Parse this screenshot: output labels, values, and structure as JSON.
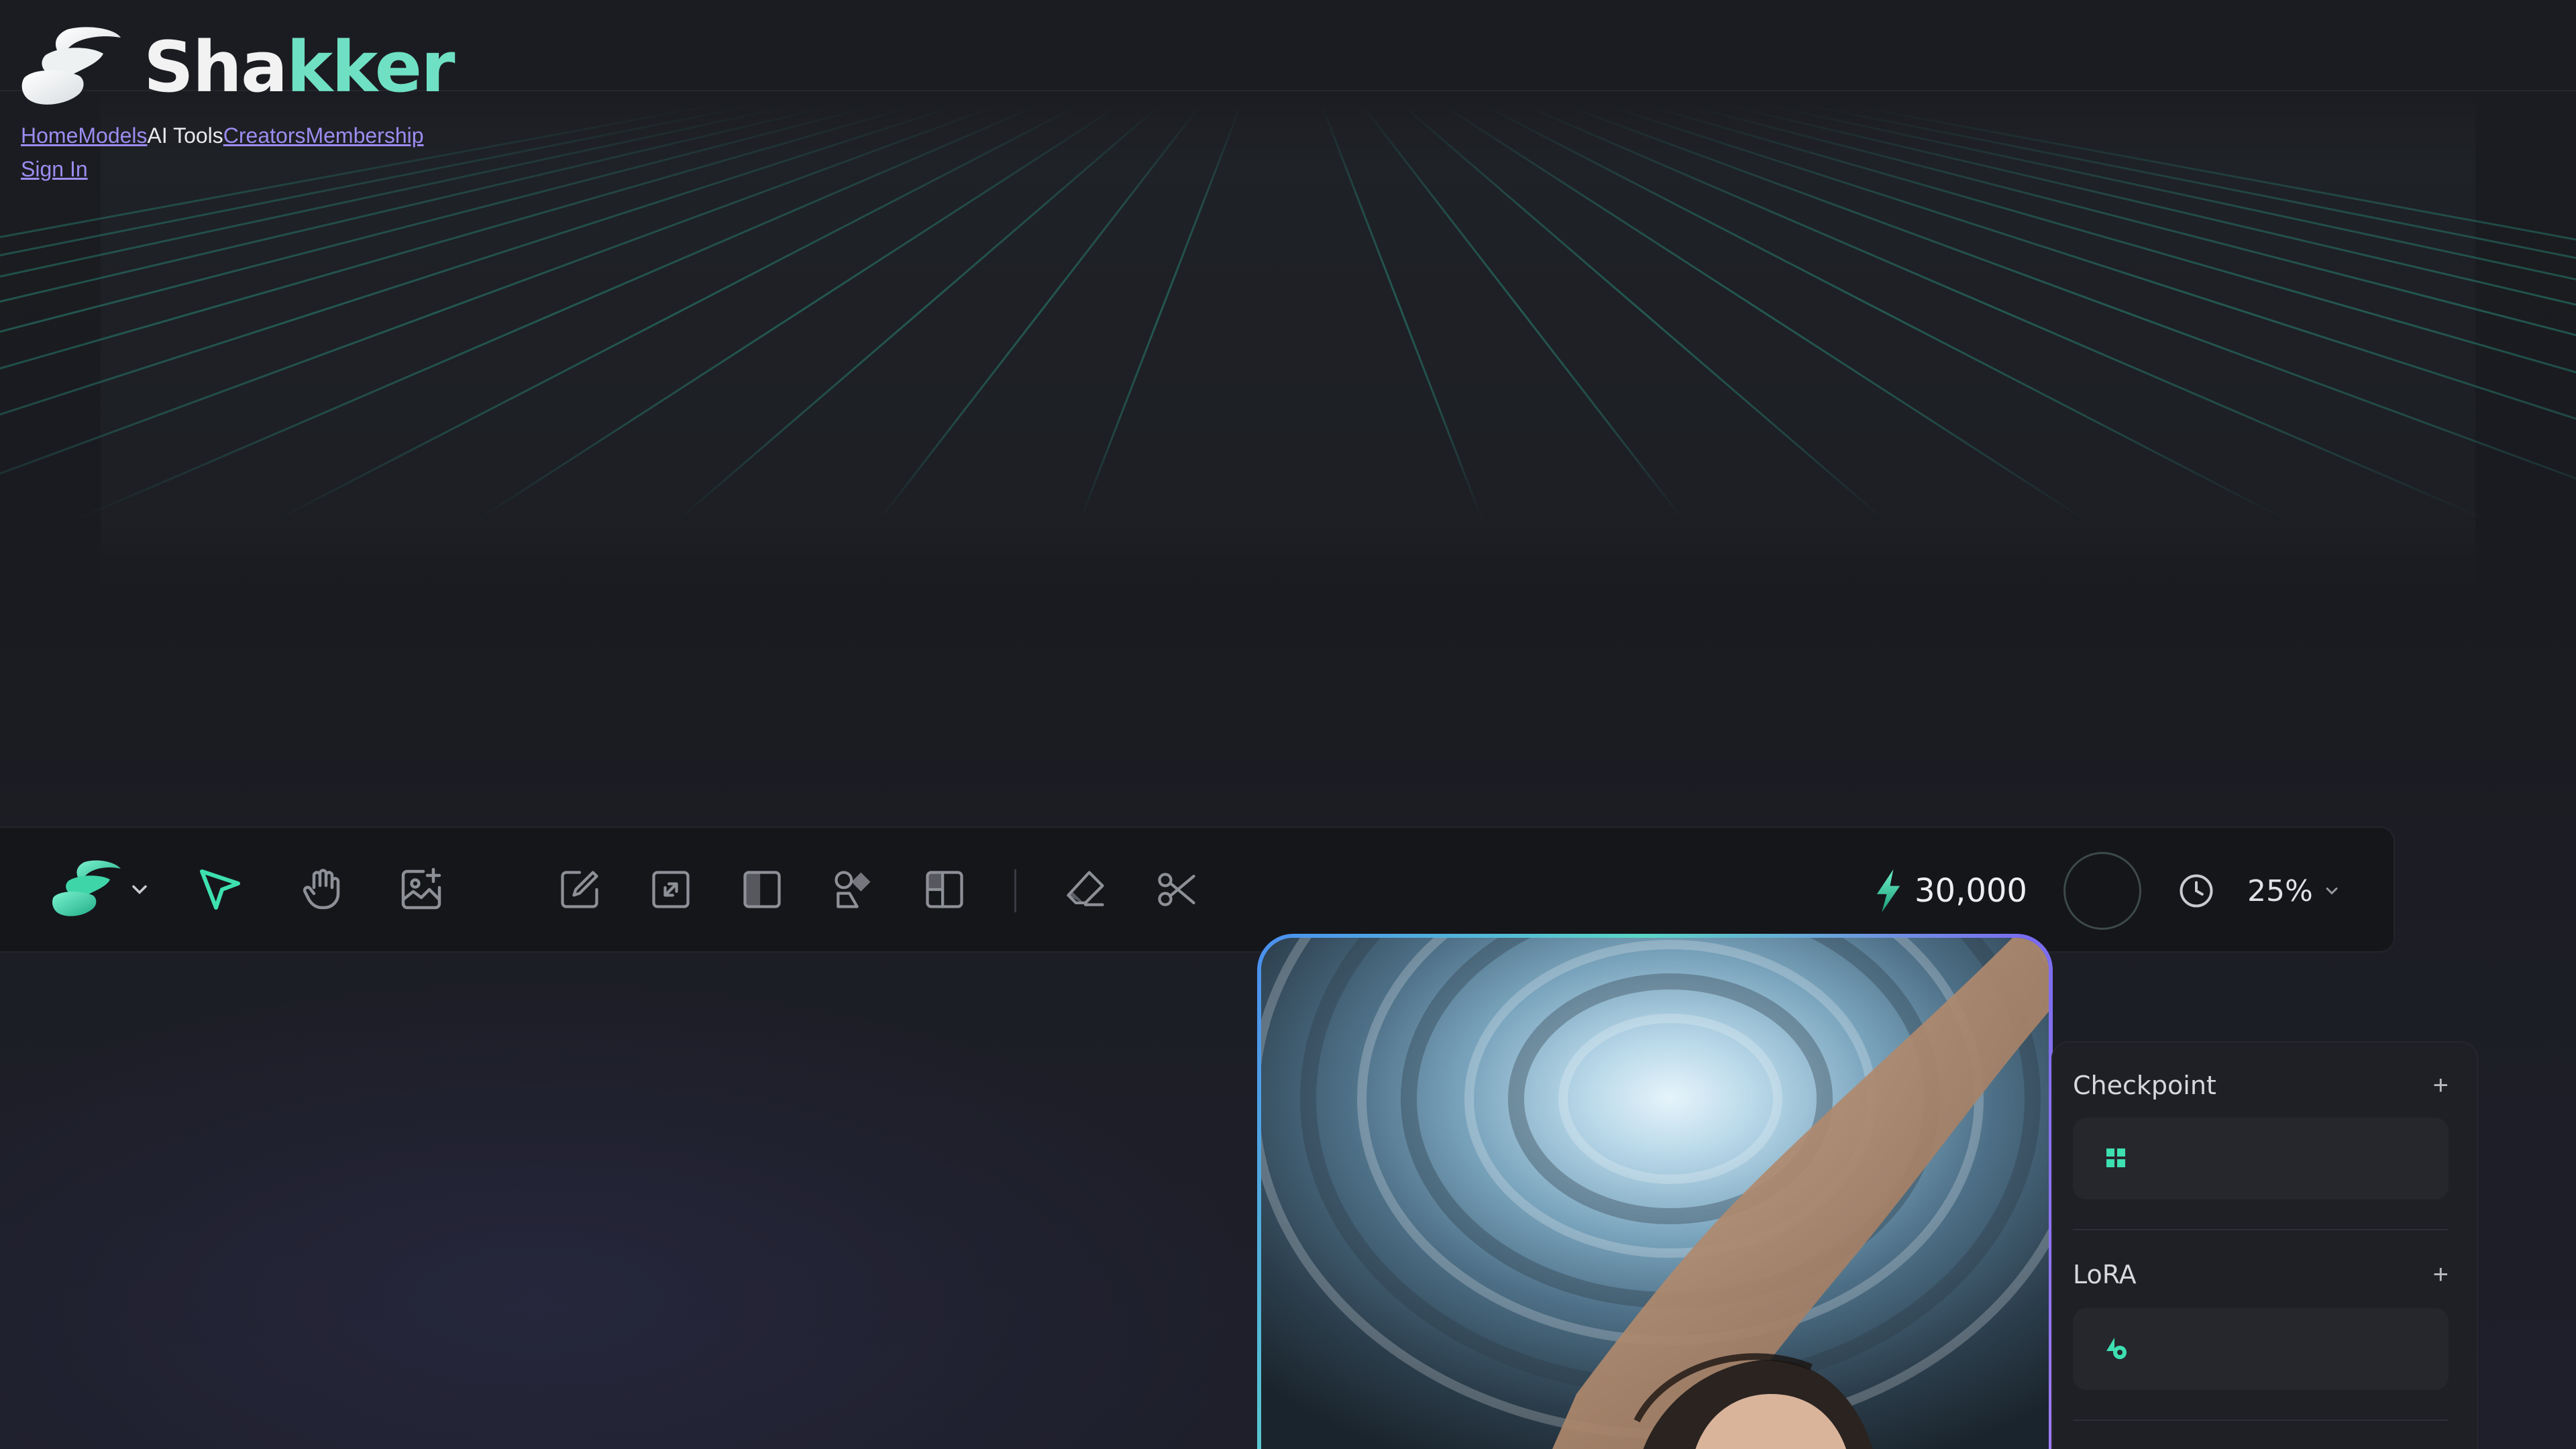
{
  "brand": {
    "name_main": "Sha",
    "name_accent": "kker"
  },
  "nav": {
    "items": [
      {
        "label": "Home",
        "link": true
      },
      {
        "label": "Models",
        "link": true
      },
      {
        "label": "AI Tools",
        "link": false
      },
      {
        "label": "Creators",
        "link": true
      },
      {
        "label": "Membership",
        "link": true
      }
    ],
    "sign_in": "Sign In"
  },
  "toolbar": {
    "tools": [
      {
        "name": "select-tool",
        "icon": "cursor-arrow-icon",
        "active": true
      },
      {
        "name": "hand-tool",
        "icon": "hand-icon"
      },
      {
        "name": "add-image-tool",
        "icon": "image-add-icon"
      },
      {
        "name": "draw-tool",
        "icon": "pencil-frame-icon"
      },
      {
        "name": "upscale-tool",
        "icon": "expand-icon"
      },
      {
        "name": "mirror-tool",
        "icon": "split-panel-icon"
      },
      {
        "name": "style-tool",
        "icon": "shapes-icon"
      },
      {
        "name": "layout-tool",
        "icon": "layout-icon"
      },
      {
        "name": "eraser-tool",
        "icon": "eraser-icon"
      },
      {
        "name": "cut-tool",
        "icon": "scissors-icon"
      }
    ],
    "credits": "30,000",
    "zoom": "25%"
  },
  "panel": {
    "checkpoint_title": "Checkpoint",
    "lora_title": "LoRA",
    "add_symbol": "+"
  },
  "colors": {
    "accent": "#3ee0b0",
    "link": "#9c8cf0",
    "background": "#1a1b20"
  }
}
